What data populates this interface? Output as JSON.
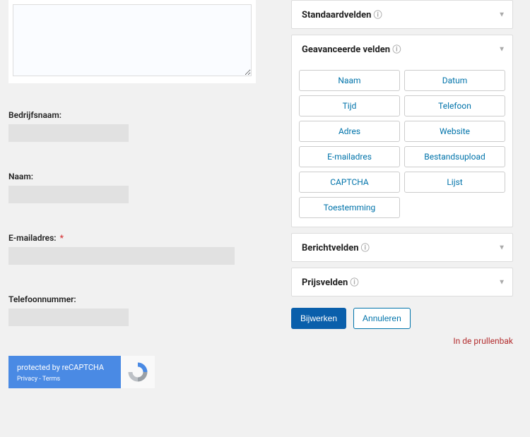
{
  "form": {
    "textarea_value": "",
    "fields": {
      "company": {
        "label": "Bedrijfsnaam:",
        "value": ""
      },
      "name": {
        "label": "Naam:",
        "value": ""
      },
      "email": {
        "label": "E-mailadres:",
        "value": "",
        "required": true
      },
      "phone": {
        "label": "Telefoonnummer:",
        "value": ""
      }
    }
  },
  "captcha": {
    "text": "protected by reCAPTCHA",
    "privacy": "Privacy",
    "sep": " - ",
    "terms": "Terms"
  },
  "panels": {
    "standard": {
      "title": "Standaardvelden"
    },
    "advanced": {
      "title": "Geavanceerde velden",
      "items": [
        "Naam",
        "Datum",
        "Tijd",
        "Telefoon",
        "Adres",
        "Website",
        "E-mailadres",
        "Bestandsupload",
        "CAPTCHA",
        "Lijst",
        "Toestemming"
      ]
    },
    "message": {
      "title": "Berichtvelden"
    },
    "price": {
      "title": "Prijsvelden"
    }
  },
  "actions": {
    "update": "Bijwerken",
    "cancel": "Annuleren",
    "trash": "In de prullenbak"
  }
}
